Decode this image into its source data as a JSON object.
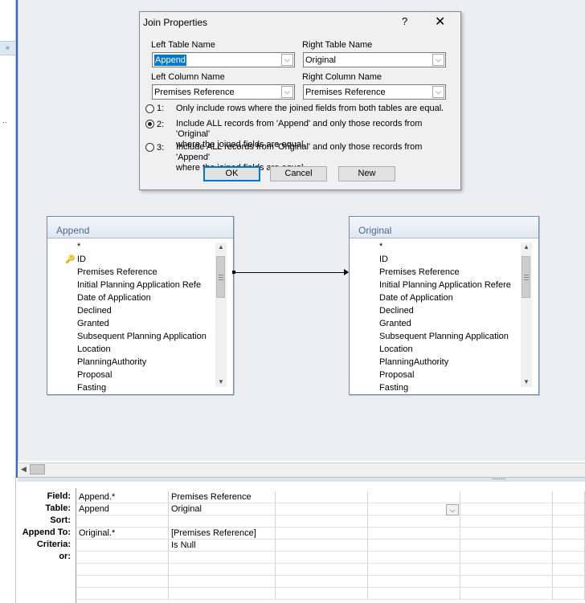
{
  "dialog": {
    "title": "Join Properties",
    "help": "?",
    "close": "✕",
    "left_table_label": "Left Table Name",
    "left_table_value": "Append",
    "right_table_label": "Right Table Name",
    "right_table_value": "Original",
    "left_column_label": "Left Column Name",
    "left_column_value": "Premises Reference",
    "right_column_label": "Right Column Name",
    "right_column_value": "Premises Reference",
    "options": [
      {
        "num": "1:",
        "line1": "Only include rows where the joined fields from both tables are equal.",
        "line2": "",
        "selected": false
      },
      {
        "num": "2:",
        "line1": "Include ALL records from 'Append' and only those records from 'Original'",
        "line2": "where the joined fields are equal.",
        "selected": true
      },
      {
        "num": "3:",
        "line1": "Include ALL records from 'Original' and only those records from 'Append'",
        "line2": "where the joined fields are equal.",
        "selected": false
      }
    ],
    "ok_label": "OK",
    "cancel_label": "Cancel",
    "new_label": "New"
  },
  "tables": {
    "left": {
      "name": "Append",
      "fields": [
        "*",
        "ID",
        "Premises Reference",
        "Initial Planning Application Refe",
        "Date of Application",
        "Declined",
        "Granted",
        "Subsequent Planning Application",
        "Location",
        "PlanningAuthority",
        "Proposal",
        "Fasting"
      ]
    },
    "right": {
      "name": "Original",
      "fields": [
        "*",
        "ID",
        "Premises Reference",
        "Initial Planning Application Refere",
        "Date of Application",
        "Declined",
        "Granted",
        "Subsequent Planning Application",
        "Location",
        "PlanningAuthority",
        "Proposal",
        "Fasting"
      ]
    }
  },
  "grid": {
    "labels": [
      "Field:",
      "Table:",
      "Sort:",
      "Append To:",
      "Criteria:",
      "or:"
    ],
    "columns": [
      {
        "field": "Append.*",
        "table": "Append",
        "sort": "",
        "append_to": "Original.*",
        "criteria": "",
        "or": ""
      },
      {
        "field": "Premises Reference",
        "table": "Original",
        "sort": "",
        "append_to": "[Premises Reference]",
        "criteria": "Is Null",
        "or": ""
      }
    ]
  }
}
